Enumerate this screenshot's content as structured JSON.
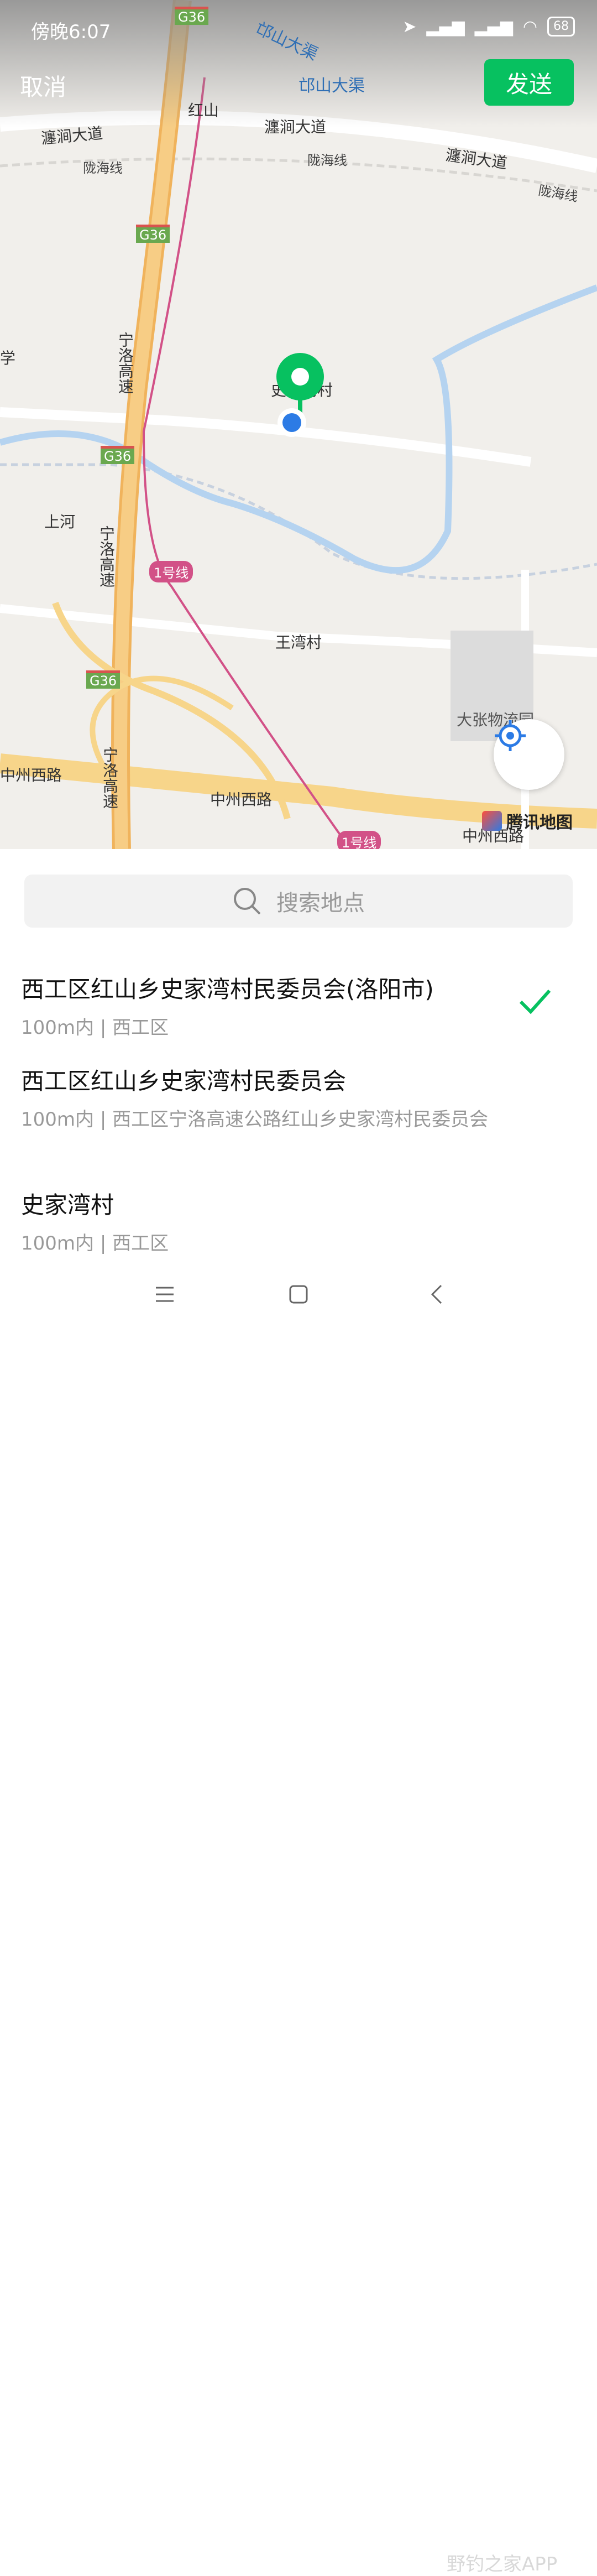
{
  "status_bar": {
    "time": "傍晚6:07",
    "battery": "68"
  },
  "header": {
    "cancel_label": "取消",
    "send_label": "发送"
  },
  "map": {
    "labels": {
      "qiushan_canal_1": "邙山大渠",
      "qiushan_canal_2": "邙山大渠",
      "hongshan": "红山",
      "chanjian_1": "瀍涧大道",
      "chanjian_2": "瀍涧大道",
      "chanjian_3": "瀍涧大道",
      "longhai_1": "陇海线",
      "longhai_2": "陇海线",
      "longhai_3": "陇海线",
      "g36_1": "G36",
      "g36_2": "G36",
      "g36_3": "G36",
      "g36_4": "G36",
      "ningluo_1": "宁洛高速",
      "ningluo_2": "宁洛高速",
      "ningluo_3": "宁洛高速",
      "shangheh": "上河",
      "line1_a": "1号线",
      "line1_b": "1号线",
      "wangwan": "王湾村",
      "dazhang": "大张物流园",
      "zhongzhou_1": "中州西路",
      "zhongzhou_2": "中州西路",
      "zhongzhou_3": "中州西路",
      "shijiawan_partial": "史家湾村",
      "xue_partial": "学"
    },
    "provider": "腾讯地图"
  },
  "search": {
    "placeholder": "搜索地点"
  },
  "places": [
    {
      "name": "西工区红山乡史家湾村民委员会(洛阳市)",
      "detail": "100m内 | 西工区",
      "selected": true
    },
    {
      "name": "西工区红山乡史家湾村民委员会",
      "detail": "100m内 | 西工区宁洛高速公路红山乡史家湾村民委员会",
      "selected": false
    },
    {
      "name": "史家湾村",
      "detail": "100m内 | 西工区",
      "selected": false
    }
  ],
  "watermark": "野钓之家APP",
  "colors": {
    "accent": "#07c160",
    "pin": "#07c160",
    "location": "#2c7be5"
  }
}
